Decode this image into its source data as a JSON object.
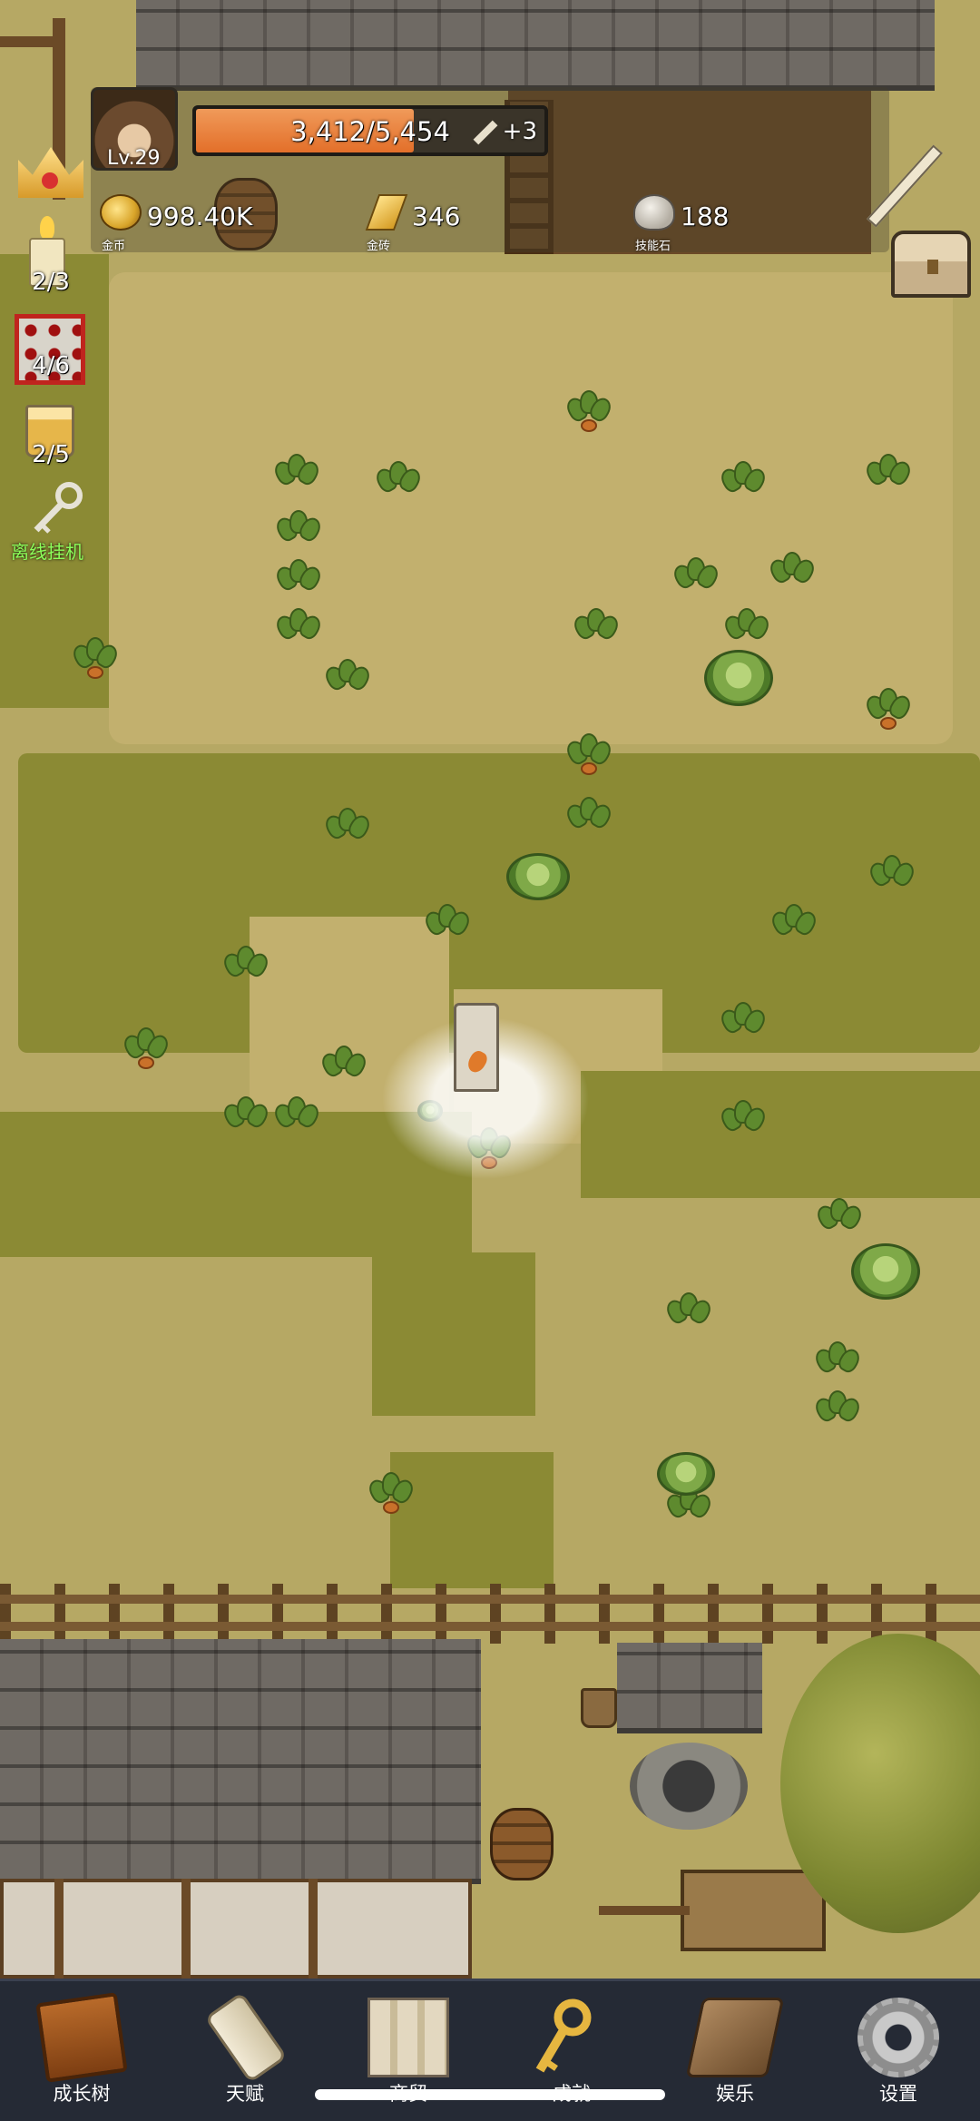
{
  "player": {
    "level": "Lv.29",
    "xp": "3,412/5,454",
    "xp_progress": 0.626,
    "bonus": "+3"
  },
  "resources": [
    {
      "name": "coin-icon",
      "value": "998.40K",
      "label": "金币"
    },
    {
      "name": "gold-bar-icon",
      "value": "346",
      "label": "金砖"
    },
    {
      "name": "skill-stone-icon",
      "value": "188",
      "label": "技能石"
    }
  ],
  "side_counters": {
    "candle": "2/3",
    "dice": "4/6",
    "beer": "2/5",
    "auto_label": "离线挂机"
  },
  "nav": [
    {
      "icon": "book-icon",
      "label": "成长树"
    },
    {
      "icon": "scroll-icon",
      "label": "天赋"
    },
    {
      "icon": "map-icon",
      "label": "商贸"
    },
    {
      "icon": "key-icon",
      "label": "成就"
    },
    {
      "icon": "cloth-icon",
      "label": "娱乐"
    },
    {
      "icon": "gear-icon",
      "label": "设置"
    }
  ],
  "colors": {
    "xp_bar": "#e36f2a",
    "nav_bg": "#252a35",
    "auto_label": "#8cff5a"
  }
}
